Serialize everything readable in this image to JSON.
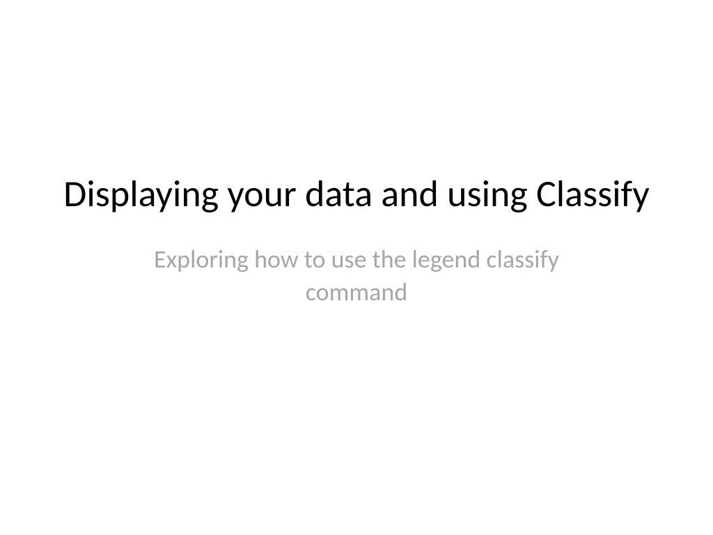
{
  "slide": {
    "title": "Displaying your data and using Classify",
    "subtitle": "Exploring how to use the legend classify command"
  }
}
